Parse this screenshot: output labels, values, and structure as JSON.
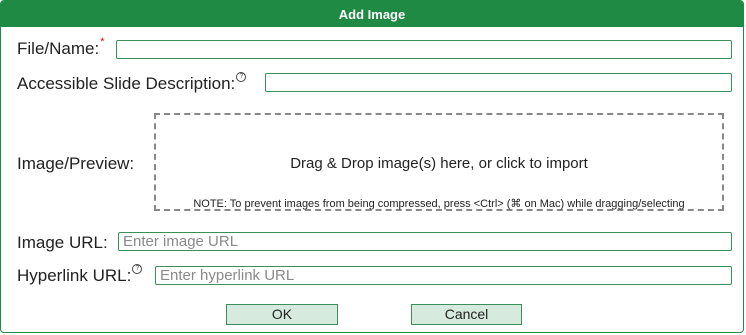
{
  "dialog": {
    "title": "Add Image"
  },
  "fields": {
    "file_name": {
      "label": "File/Name:",
      "required_mark": "*",
      "value": "",
      "placeholder": ""
    },
    "description": {
      "label": "Accessible Slide Description:",
      "help_glyph": "?",
      "value": "",
      "placeholder": ""
    },
    "preview": {
      "label": "Image/Preview:",
      "drop_text": "Drag & Drop image(s) here, or click to import",
      "note": "NOTE: To prevent images from being compressed, press <Ctrl> (⌘ on Mac) while dragging/selecting"
    },
    "image_url": {
      "label": "Image URL:",
      "value": "",
      "placeholder": "Enter image URL"
    },
    "hyperlink_url": {
      "label": "Hyperlink URL:",
      "help_glyph": "?",
      "value": "",
      "placeholder": "Enter hyperlink URL"
    }
  },
  "buttons": {
    "ok": "OK",
    "cancel": "Cancel"
  },
  "colors": {
    "title_bar": "#1e8a44",
    "button_bg": "#d6eadd",
    "required": "#cc1111",
    "field_border": "#3a8f5a"
  },
  "icons": {
    "help": "help-circle-icon"
  }
}
